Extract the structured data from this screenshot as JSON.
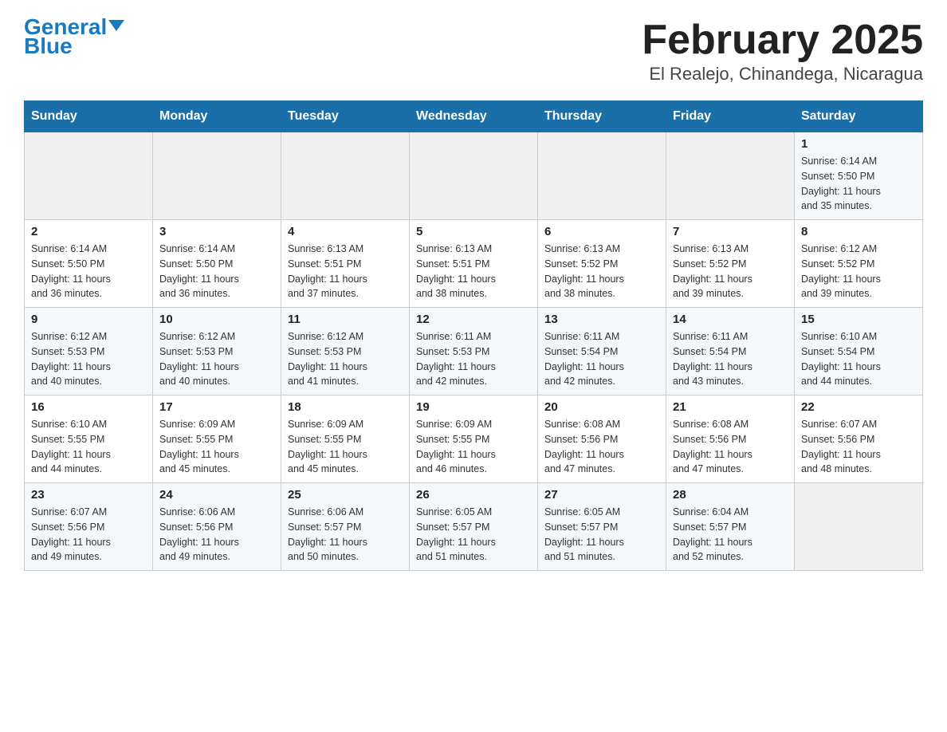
{
  "header": {
    "logo_general": "General",
    "logo_blue": "Blue",
    "title": "February 2025",
    "subtitle": "El Realejo, Chinandega, Nicaragua"
  },
  "days_of_week": [
    "Sunday",
    "Monday",
    "Tuesday",
    "Wednesday",
    "Thursday",
    "Friday",
    "Saturday"
  ],
  "weeks": [
    [
      {
        "day": "",
        "info": ""
      },
      {
        "day": "",
        "info": ""
      },
      {
        "day": "",
        "info": ""
      },
      {
        "day": "",
        "info": ""
      },
      {
        "day": "",
        "info": ""
      },
      {
        "day": "",
        "info": ""
      },
      {
        "day": "1",
        "info": "Sunrise: 6:14 AM\nSunset: 5:50 PM\nDaylight: 11 hours\nand 35 minutes."
      }
    ],
    [
      {
        "day": "2",
        "info": "Sunrise: 6:14 AM\nSunset: 5:50 PM\nDaylight: 11 hours\nand 36 minutes."
      },
      {
        "day": "3",
        "info": "Sunrise: 6:14 AM\nSunset: 5:50 PM\nDaylight: 11 hours\nand 36 minutes."
      },
      {
        "day": "4",
        "info": "Sunrise: 6:13 AM\nSunset: 5:51 PM\nDaylight: 11 hours\nand 37 minutes."
      },
      {
        "day": "5",
        "info": "Sunrise: 6:13 AM\nSunset: 5:51 PM\nDaylight: 11 hours\nand 38 minutes."
      },
      {
        "day": "6",
        "info": "Sunrise: 6:13 AM\nSunset: 5:52 PM\nDaylight: 11 hours\nand 38 minutes."
      },
      {
        "day": "7",
        "info": "Sunrise: 6:13 AM\nSunset: 5:52 PM\nDaylight: 11 hours\nand 39 minutes."
      },
      {
        "day": "8",
        "info": "Sunrise: 6:12 AM\nSunset: 5:52 PM\nDaylight: 11 hours\nand 39 minutes."
      }
    ],
    [
      {
        "day": "9",
        "info": "Sunrise: 6:12 AM\nSunset: 5:53 PM\nDaylight: 11 hours\nand 40 minutes."
      },
      {
        "day": "10",
        "info": "Sunrise: 6:12 AM\nSunset: 5:53 PM\nDaylight: 11 hours\nand 40 minutes."
      },
      {
        "day": "11",
        "info": "Sunrise: 6:12 AM\nSunset: 5:53 PM\nDaylight: 11 hours\nand 41 minutes."
      },
      {
        "day": "12",
        "info": "Sunrise: 6:11 AM\nSunset: 5:53 PM\nDaylight: 11 hours\nand 42 minutes."
      },
      {
        "day": "13",
        "info": "Sunrise: 6:11 AM\nSunset: 5:54 PM\nDaylight: 11 hours\nand 42 minutes."
      },
      {
        "day": "14",
        "info": "Sunrise: 6:11 AM\nSunset: 5:54 PM\nDaylight: 11 hours\nand 43 minutes."
      },
      {
        "day": "15",
        "info": "Sunrise: 6:10 AM\nSunset: 5:54 PM\nDaylight: 11 hours\nand 44 minutes."
      }
    ],
    [
      {
        "day": "16",
        "info": "Sunrise: 6:10 AM\nSunset: 5:55 PM\nDaylight: 11 hours\nand 44 minutes."
      },
      {
        "day": "17",
        "info": "Sunrise: 6:09 AM\nSunset: 5:55 PM\nDaylight: 11 hours\nand 45 minutes."
      },
      {
        "day": "18",
        "info": "Sunrise: 6:09 AM\nSunset: 5:55 PM\nDaylight: 11 hours\nand 45 minutes."
      },
      {
        "day": "19",
        "info": "Sunrise: 6:09 AM\nSunset: 5:55 PM\nDaylight: 11 hours\nand 46 minutes."
      },
      {
        "day": "20",
        "info": "Sunrise: 6:08 AM\nSunset: 5:56 PM\nDaylight: 11 hours\nand 47 minutes."
      },
      {
        "day": "21",
        "info": "Sunrise: 6:08 AM\nSunset: 5:56 PM\nDaylight: 11 hours\nand 47 minutes."
      },
      {
        "day": "22",
        "info": "Sunrise: 6:07 AM\nSunset: 5:56 PM\nDaylight: 11 hours\nand 48 minutes."
      }
    ],
    [
      {
        "day": "23",
        "info": "Sunrise: 6:07 AM\nSunset: 5:56 PM\nDaylight: 11 hours\nand 49 minutes."
      },
      {
        "day": "24",
        "info": "Sunrise: 6:06 AM\nSunset: 5:56 PM\nDaylight: 11 hours\nand 49 minutes."
      },
      {
        "day": "25",
        "info": "Sunrise: 6:06 AM\nSunset: 5:57 PM\nDaylight: 11 hours\nand 50 minutes."
      },
      {
        "day": "26",
        "info": "Sunrise: 6:05 AM\nSunset: 5:57 PM\nDaylight: 11 hours\nand 51 minutes."
      },
      {
        "day": "27",
        "info": "Sunrise: 6:05 AM\nSunset: 5:57 PM\nDaylight: 11 hours\nand 51 minutes."
      },
      {
        "day": "28",
        "info": "Sunrise: 6:04 AM\nSunset: 5:57 PM\nDaylight: 11 hours\nand 52 minutes."
      },
      {
        "day": "",
        "info": ""
      }
    ]
  ]
}
